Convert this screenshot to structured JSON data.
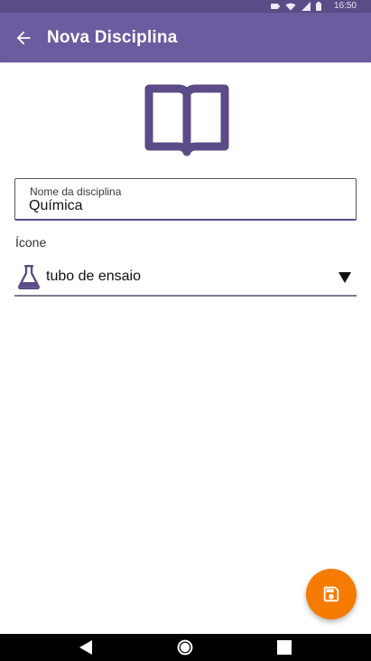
{
  "status_bar": {
    "time": "16:50",
    "icons": [
      "battery-saver-icon",
      "wifi-icon",
      "signal-icon",
      "battery-icon"
    ],
    "background": "#5b4b87"
  },
  "app_bar": {
    "title": "Nova Disciplina",
    "back_icon": "back-arrow-icon",
    "background": "#6c5b9f"
  },
  "header_icon": {
    "name": "open-book-icon",
    "color": "#5b4b87"
  },
  "name_field": {
    "label": "Nome da disciplina",
    "value": "Química"
  },
  "icon_selector": {
    "section_label": "Ícone",
    "selected_icon": "flask-icon",
    "selected_value": "tubo de ensaio"
  },
  "fab": {
    "icon": "save-icon",
    "color": "#f57c00"
  },
  "nav_bar": {
    "buttons": [
      "back-triangle-icon",
      "home-circle-icon",
      "recents-square-icon"
    ]
  }
}
